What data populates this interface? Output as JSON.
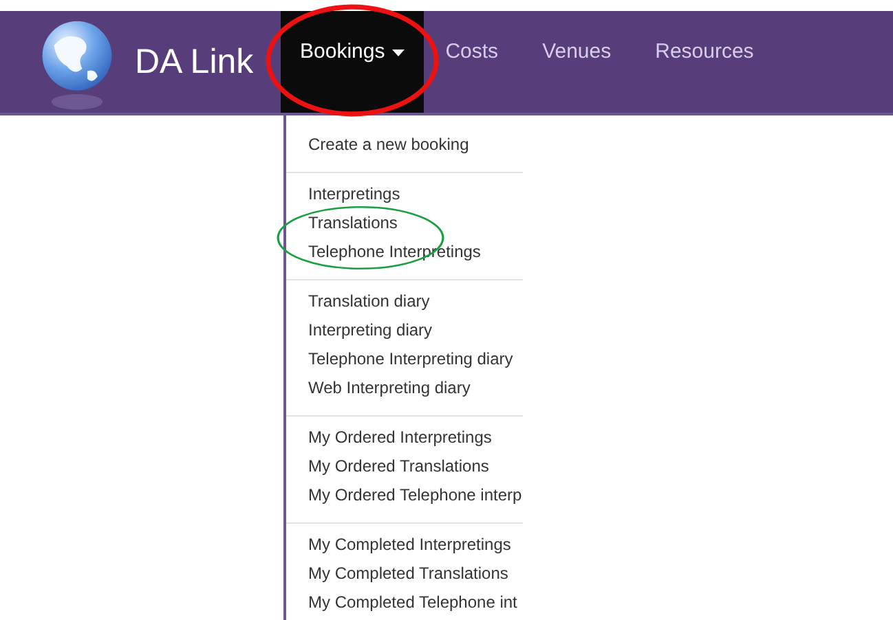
{
  "brand": {
    "name": "DA Link"
  },
  "nav": [
    {
      "label": "Bookings",
      "selected": true,
      "dropdown": true,
      "circled": true
    },
    {
      "label": "Costs",
      "selected": false,
      "dropdown": false,
      "circled": false
    },
    {
      "label": "Venues",
      "selected": false,
      "dropdown": false,
      "circled": false
    },
    {
      "label": "Resources",
      "selected": false,
      "dropdown": false,
      "circled": false
    }
  ],
  "menu": {
    "groups": [
      [
        {
          "label": "Create a new booking",
          "circled": false
        }
      ],
      [
        {
          "label": "Interpretings",
          "circled": false
        },
        {
          "label": "Translations",
          "circled": true
        },
        {
          "label": "Telephone Interpretings",
          "circled": true
        }
      ],
      [
        {
          "label": "Translation diary",
          "circled": false
        },
        {
          "label": "Interpreting diary",
          "circled": false
        },
        {
          "label": "Telephone Interpreting diary",
          "circled": false
        },
        {
          "label": "Web Interpreting diary",
          "circled": false
        }
      ],
      [
        {
          "label": "My Ordered Interpretings",
          "circled": false
        },
        {
          "label": "My Ordered Translations",
          "circled": false
        },
        {
          "label": "My Ordered Telephone interp",
          "circled": false
        }
      ],
      [
        {
          "label": "My Completed Interpretings",
          "circled": false
        },
        {
          "label": "My Completed Translations",
          "circled": false
        },
        {
          "label": "My Completed Telephone int",
          "circled": false
        }
      ]
    ]
  }
}
